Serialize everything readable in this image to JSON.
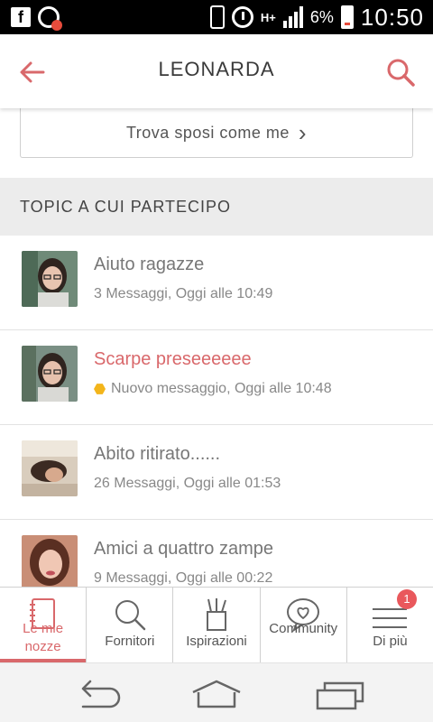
{
  "status_bar": {
    "fb_glyph": "f",
    "network_type": "H+",
    "battery_percent": "6%",
    "time": "10:50"
  },
  "header": {
    "title": "LEONARDA",
    "accent_color": "#d9686b"
  },
  "find_button": {
    "label": "Trova sposi come me",
    "chevron": "›"
  },
  "section": {
    "title": "TOPIC A CUI PARTECIPO"
  },
  "topics": [
    {
      "title": "Aiuto ragazze",
      "subtitle": "3 Messaggi, Oggi alle 10:49",
      "unread": false
    },
    {
      "title": "Scarpe preseeeeee",
      "subtitle": "Nuovo messaggio, Oggi alle 10:48",
      "unread": true
    },
    {
      "title": "Abito ritirato......",
      "subtitle": "26 Messaggi, Oggi alle 01:53",
      "unread": false
    },
    {
      "title": "Amici a quattro zampe",
      "subtitle": "9 Messaggi, Oggi alle 00:22",
      "unread": false
    }
  ],
  "tabbar": {
    "tabs": [
      {
        "label": "Le mie nozze",
        "icon": "notebook-icon",
        "active": true
      },
      {
        "label": "Fornitori",
        "icon": "search-icon",
        "active": false
      },
      {
        "label": "Ispirazioni",
        "icon": "pencil-cup-icon",
        "active": false
      },
      {
        "label": "Community",
        "icon": "heart-bubble-icon",
        "active": false
      },
      {
        "label": "Di più",
        "icon": "menu-icon",
        "active": false
      }
    ],
    "badge_count": "1"
  }
}
